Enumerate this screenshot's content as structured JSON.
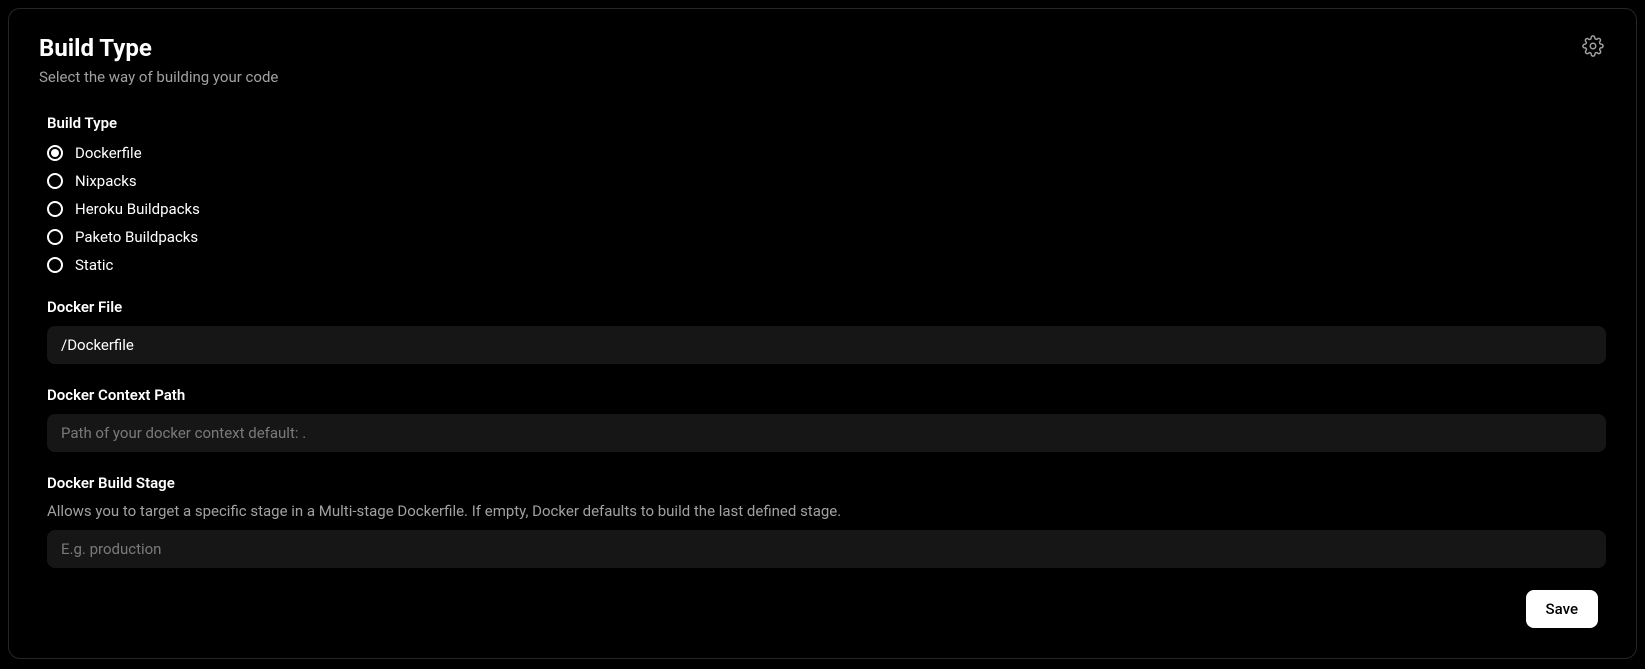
{
  "card": {
    "title": "Build Type",
    "subtitle": "Select the way of building your code"
  },
  "buildType": {
    "label": "Build Type",
    "options": [
      {
        "label": "Dockerfile",
        "selected": true
      },
      {
        "label": "Nixpacks",
        "selected": false
      },
      {
        "label": "Heroku Buildpacks",
        "selected": false
      },
      {
        "label": "Paketo Buildpacks",
        "selected": false
      },
      {
        "label": "Static",
        "selected": false
      }
    ]
  },
  "dockerFile": {
    "label": "Docker File",
    "value": "/Dockerfile"
  },
  "dockerContext": {
    "label": "Docker Context Path",
    "value": "",
    "placeholder": "Path of your docker context default: ."
  },
  "dockerBuildStage": {
    "label": "Docker Build Stage",
    "help": "Allows you to target a specific stage in a Multi-stage Dockerfile. If empty, Docker defaults to build the last defined stage.",
    "value": "",
    "placeholder": "E.g. production"
  },
  "footer": {
    "saveLabel": "Save"
  }
}
